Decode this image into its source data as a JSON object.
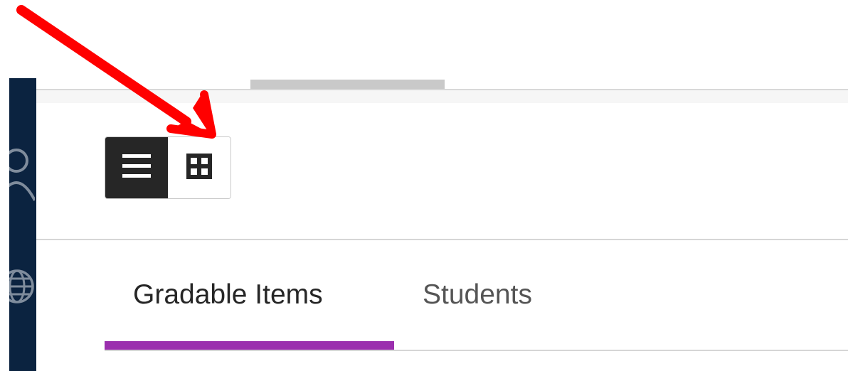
{
  "view_toggle": {
    "list_icon": "list-icon",
    "grid_icon": "grid-icon",
    "active_view": "list"
  },
  "nav": {
    "icons": [
      "user-icon",
      "globe-icon"
    ]
  },
  "tabs": [
    {
      "label": "Gradable Items",
      "active": true
    },
    {
      "label": "Students",
      "active": false
    }
  ],
  "annotation": {
    "icon": "red-arrow-icon",
    "color": "#ff0000"
  },
  "colors": {
    "nav_background": "#0b2340",
    "active_tab_underline": "#9b2fae",
    "active_toggle_background": "#262626"
  }
}
